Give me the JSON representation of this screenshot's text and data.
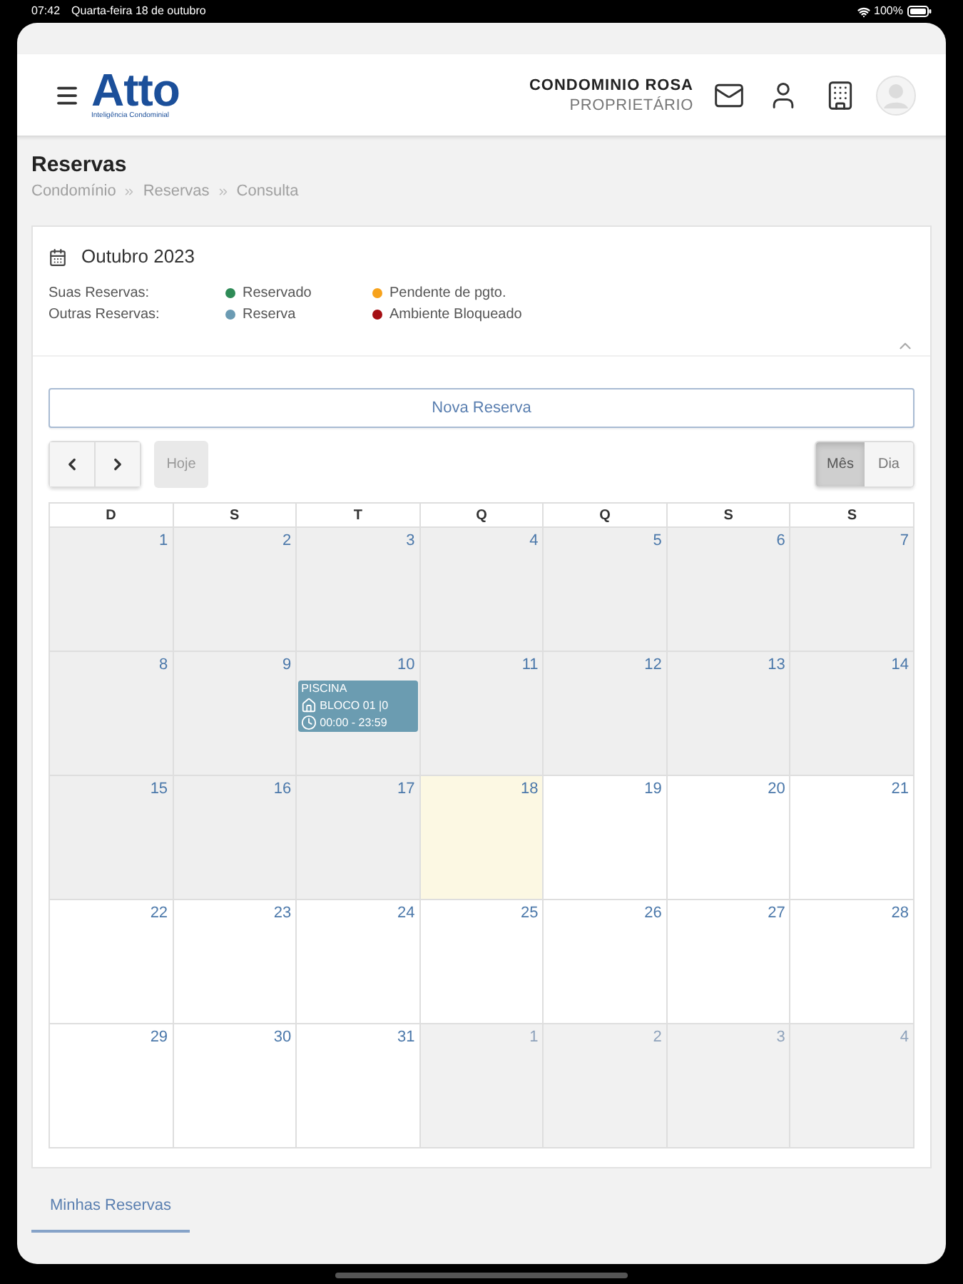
{
  "status_bar": {
    "time": "07:42",
    "date": "Quarta-feira 18 de outubro",
    "battery": "100%"
  },
  "header": {
    "logo": {
      "name": "Atto",
      "tagline": "Inteligência Condominial"
    },
    "condo": "CONDOMINIO ROSA",
    "role": "PROPRIETÁRIO"
  },
  "page": {
    "title": "Reservas",
    "breadcrumb": [
      "Condomínio",
      "Reservas",
      "Consulta"
    ]
  },
  "calendar_card": {
    "month": "Outubro 2023",
    "expanded": true,
    "legend": [
      {
        "label": "Suas Reservas:",
        "items": [
          {
            "label": "Reservado",
            "color": "#2e8b57"
          },
          {
            "label": "Pendente de pgto.",
            "color": "#f7a21b"
          }
        ]
      },
      {
        "label": "Outras Reservas:",
        "items": [
          {
            "label": "Reserva",
            "color": "#6b9bb3"
          },
          {
            "label": "Ambiente Bloqueado",
            "color": "#a50f14"
          }
        ]
      }
    ],
    "new_button": "Nova Reserva",
    "today_button": {
      "label": "Hoje",
      "disabled": true
    },
    "views": [
      {
        "label": "Mês",
        "selected": true
      },
      {
        "label": "Dia",
        "selected": false
      }
    ],
    "weekdays": [
      "D",
      "S",
      "T",
      "Q",
      "Q",
      "S",
      "S"
    ],
    "weeks": [
      [
        {
          "day": "1",
          "kind": "past"
        },
        {
          "day": "2",
          "kind": "past"
        },
        {
          "day": "3",
          "kind": "past"
        },
        {
          "day": "4",
          "kind": "past"
        },
        {
          "day": "5",
          "kind": "past"
        },
        {
          "day": "6",
          "kind": "past"
        },
        {
          "day": "7",
          "kind": "past"
        }
      ],
      [
        {
          "day": "8",
          "kind": "past"
        },
        {
          "day": "9",
          "kind": "past"
        },
        {
          "day": "10",
          "kind": "past",
          "events": [
            {
              "title": "PISCINA",
              "place": "BLOCO 01 |0",
              "time": "00:00 - 23:59",
              "color": "#6b9cb1"
            }
          ]
        },
        {
          "day": "11",
          "kind": "past"
        },
        {
          "day": "12",
          "kind": "past"
        },
        {
          "day": "13",
          "kind": "past"
        },
        {
          "day": "14",
          "kind": "past"
        }
      ],
      [
        {
          "day": "15",
          "kind": "past"
        },
        {
          "day": "16",
          "kind": "past"
        },
        {
          "day": "17",
          "kind": "past"
        },
        {
          "day": "18",
          "kind": "today"
        },
        {
          "day": "19",
          "kind": "future"
        },
        {
          "day": "20",
          "kind": "future"
        },
        {
          "day": "21",
          "kind": "future"
        }
      ],
      [
        {
          "day": "22",
          "kind": "future"
        },
        {
          "day": "23",
          "kind": "future"
        },
        {
          "day": "24",
          "kind": "future"
        },
        {
          "day": "25",
          "kind": "future"
        },
        {
          "day": "26",
          "kind": "future"
        },
        {
          "day": "27",
          "kind": "future"
        },
        {
          "day": "28",
          "kind": "future"
        }
      ],
      [
        {
          "day": "29",
          "kind": "future"
        },
        {
          "day": "30",
          "kind": "future"
        },
        {
          "day": "31",
          "kind": "future"
        },
        {
          "day": "1",
          "kind": "other_month"
        },
        {
          "day": "2",
          "kind": "other_month"
        },
        {
          "day": "3",
          "kind": "other_month"
        },
        {
          "day": "4",
          "kind": "other_month"
        }
      ]
    ]
  },
  "tabs": [
    {
      "label": "Minhas Reservas",
      "selected": true
    }
  ]
}
